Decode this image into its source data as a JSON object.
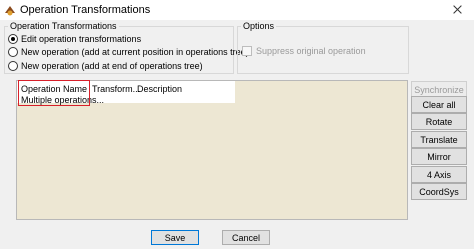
{
  "window": {
    "title": "Operation Transformations"
  },
  "transform_group": {
    "label": "Operation Transformations",
    "options": [
      {
        "label": "Edit operation transformations",
        "selected": true
      },
      {
        "label": "New operation (add at current position in operations tree)",
        "selected": false
      },
      {
        "label": "New operation (add at end of operations tree)",
        "selected": false
      }
    ]
  },
  "options_group": {
    "label": "Options",
    "suppress_label": "Suppress original operation",
    "suppress_checked": false,
    "suppress_enabled": false
  },
  "table": {
    "columns": [
      "Operation Name",
      "Transform...",
      "Description"
    ],
    "rows": [
      [
        "Multiple operations...",
        "",
        ""
      ]
    ]
  },
  "side_buttons": [
    {
      "label": "Synchronize",
      "enabled": false
    },
    {
      "label": "Clear all",
      "enabled": true
    },
    {
      "label": "Rotate",
      "enabled": true
    },
    {
      "label": "Translate",
      "enabled": true
    },
    {
      "label": "Mirror",
      "enabled": true
    },
    {
      "label": "4 Axis",
      "enabled": true
    },
    {
      "label": "CoordSys",
      "enabled": true
    }
  ],
  "footer": {
    "save_label": "Save",
    "cancel_label": "Cancel"
  },
  "colors": {
    "highlight": "#d8202a",
    "table_background": "#ede7d3",
    "default_button_border": "#0078d7"
  }
}
